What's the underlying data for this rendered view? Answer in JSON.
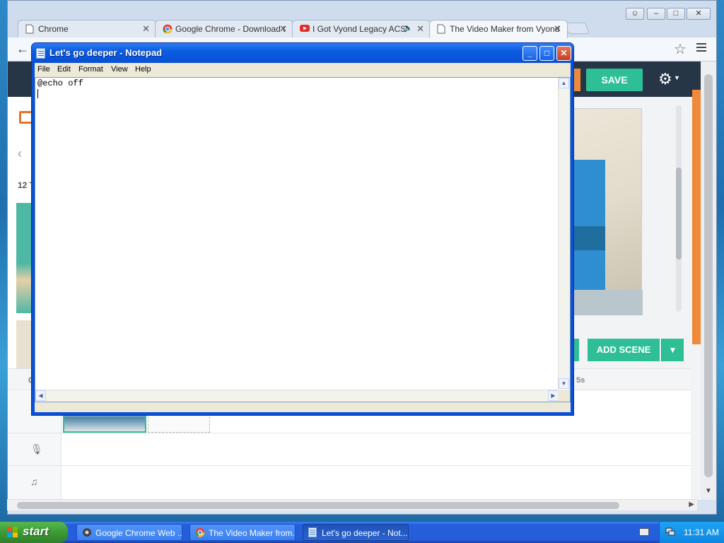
{
  "chrome": {
    "tabs": [
      {
        "title": "Chrome",
        "icon": "page-icon"
      },
      {
        "title": "Google Chrome - Download t",
        "icon": "chrome-icon"
      },
      {
        "title": "I Got Vyond Legacy ACS",
        "icon": "youtube-icon"
      },
      {
        "title": "The Video Maker from Vyond",
        "icon": "page-icon"
      }
    ],
    "window_buttons": {
      "user": "☺",
      "minimize": "–",
      "restore": "□",
      "close": "✕"
    }
  },
  "vyond": {
    "save_label": "SAVE",
    "add_scene_label": "ADD SCENE",
    "left_count": "12 T",
    "ruler_label": "5s",
    "accent_color": "#2fbf97",
    "orange_color": "#f08a3a"
  },
  "notepad": {
    "title": "Let's go deeper - Notepad",
    "menu": [
      "File",
      "Edit",
      "Format",
      "View",
      "Help"
    ],
    "content": "@echo off"
  },
  "taskbar": {
    "start_label": "start",
    "items": [
      {
        "label": "Google Chrome Web ...",
        "icon": "chrome-web-icon"
      },
      {
        "label": "The Video Maker from...",
        "icon": "chrome-icon"
      },
      {
        "label": "Let's go deeper - Not...",
        "icon": "notepad-icon"
      }
    ],
    "clock": "11:31 AM"
  }
}
